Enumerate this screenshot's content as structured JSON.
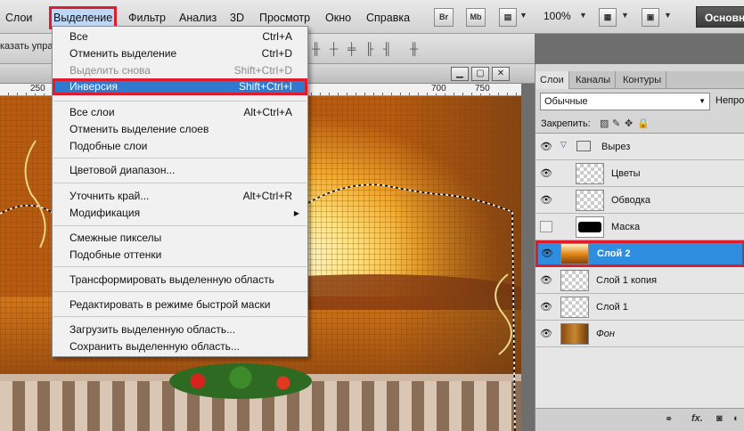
{
  "menubar": {
    "items": [
      "Слои",
      "Выделение",
      "Фильтр",
      "Анализ",
      "3D",
      "Просмотр",
      "Окно",
      "Справка"
    ],
    "icons": [
      "Br",
      "Mb"
    ],
    "zoom": "100%",
    "workspace": "Основна"
  },
  "options": {
    "text": "казать управ"
  },
  "ruler": {
    "ticks": [
      "250",
      "700",
      "750"
    ]
  },
  "dropdown": {
    "items": [
      {
        "label": "Все",
        "shortcut": "Ctrl+A"
      },
      {
        "label": "Отменить выделение",
        "shortcut": "Ctrl+D"
      },
      {
        "label": "Выделить снова",
        "shortcut": "Shift+Ctrl+D"
      },
      {
        "label": "Инверсия",
        "shortcut": "Shift+Ctrl+I"
      },
      {
        "label": "Все слои",
        "shortcut": "Alt+Ctrl+A"
      },
      {
        "label": "Отменить выделение слоев",
        "shortcut": ""
      },
      {
        "label": "Подобные слои",
        "shortcut": ""
      },
      {
        "label": "Цветовой диапазон...",
        "shortcut": ""
      },
      {
        "label": "Уточнить край...",
        "shortcut": "Alt+Ctrl+R"
      },
      {
        "label": "Модификация",
        "shortcut": ""
      },
      {
        "label": "Смежные пикселы",
        "shortcut": ""
      },
      {
        "label": "Подобные оттенки",
        "shortcut": ""
      },
      {
        "label": "Трансформировать выделенную область",
        "shortcut": ""
      },
      {
        "label": "Редактировать в режиме быстрой маски",
        "shortcut": ""
      },
      {
        "label": "Загрузить выделенную область...",
        "shortcut": ""
      },
      {
        "label": "Сохранить выделенную область...",
        "shortcut": ""
      }
    ]
  },
  "panel": {
    "tabs": [
      "Слои",
      "Каналы",
      "Контуры"
    ],
    "blend_mode": "Обычные",
    "opacity_label": "Непроз",
    "lock_label": "Закрепить:",
    "layers": [
      {
        "name": "Вырез"
      },
      {
        "name": "Цветы"
      },
      {
        "name": "Обводка"
      },
      {
        "name": "Маска"
      },
      {
        "name": "Слой 2"
      },
      {
        "name": "Слой 1 копия"
      },
      {
        "name": "Слой 1"
      },
      {
        "name": "Фон"
      }
    ],
    "footer_icons": [
      "link-icon",
      "fx-icon",
      "mask-icon"
    ]
  },
  "colors": {
    "highlight": "#2f79cf",
    "annotation_red": "#e01b2c",
    "layer_selected": "#2f8de0"
  }
}
